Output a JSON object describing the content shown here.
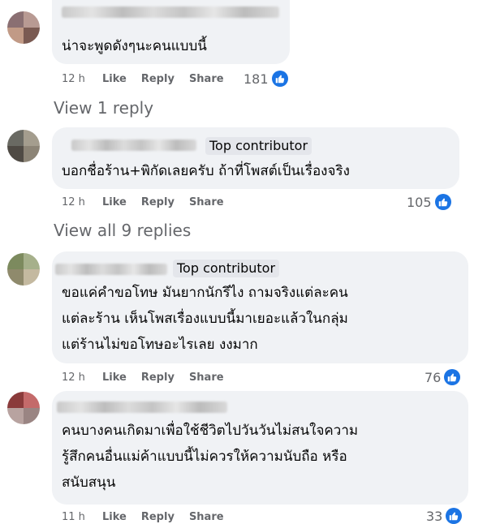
{
  "comments": [
    {
      "badge": "",
      "lines": [
        "น่าจะพูดดังๆนะคนแบบนี้"
      ],
      "time": "12 h",
      "like_label": "Like",
      "reply_label": "Reply",
      "share_label": "Share",
      "reaction_count": "181"
    },
    {
      "badge": "Top contributor",
      "lines": [
        "บอกชื่อร้าน+พิกัดเลยครับ ถ้าที่โพสต์เป็นเรื่องจริง"
      ],
      "time": "12 h",
      "like_label": "Like",
      "reply_label": "Reply",
      "share_label": "Share",
      "reaction_count": "105"
    },
    {
      "badge": "Top contributor",
      "lines": [
        "ขอแค่คำขอโทษ มันยากนักรึไง ถามจริงแต่ละคน",
        "แต่ละร้าน เห็นโพสเรื่องแบบนี้มาเยอะแล้วในกลุ่ม",
        "แต่ร้านไม่ขอโทษอะไรเลย งงมาก"
      ],
      "time": "12 h",
      "like_label": "Like",
      "reply_label": "Reply",
      "share_label": "Share",
      "reaction_count": "76"
    },
    {
      "badge": "",
      "lines": [
        "คนบางคนเกิดมาเพื่อใช้ชีวิตไปวันวันไม่สนใจความ",
        "รู้สึกคนอื่นแม่ค้าแบบนี้ไม่ควรให้ความนับถือ หรือ",
        "สนับสนุน"
      ],
      "time": "11 h",
      "like_label": "Like",
      "reply_label": "Reply",
      "share_label": "Share",
      "reaction_count": "33"
    }
  ],
  "view_replies": [
    "View 1 reply",
    "View all 9 replies"
  ],
  "colors": {
    "bubble": "#f0f2f5",
    "like_blue": "#1b74e4",
    "muted": "#65676b",
    "badge_bg": "#e4e6eb"
  },
  "icons": {
    "reaction": "thumbs-up-icon"
  }
}
